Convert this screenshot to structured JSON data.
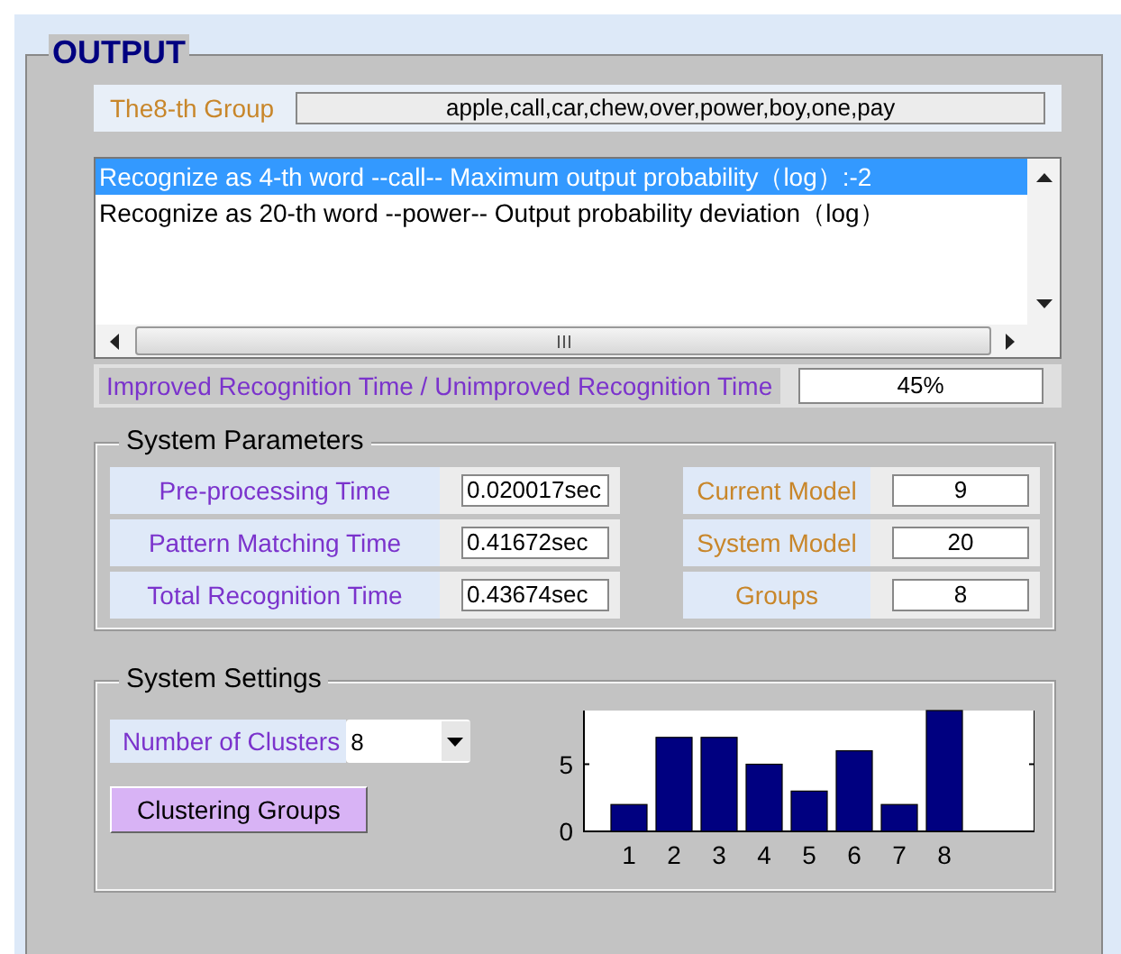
{
  "panel": {
    "title": "OUTPUT"
  },
  "group": {
    "label": "The8-th Group",
    "value": "apple,call,car,chew,over,power,boy,one,pay"
  },
  "results": [
    {
      "text": "Recognize as 4-th word --call-- Maximum output probability（log）:-2",
      "selected": true
    },
    {
      "text": "Recognize as 20-th word --power-- Output probability deviation（log）",
      "selected": false
    }
  ],
  "ratio": {
    "label": "Improved Recognition Time / Unimproved Recognition Time",
    "value": "45%"
  },
  "system_parameters": {
    "title": "System Parameters",
    "times": [
      {
        "label": "Pre-processing Time",
        "value": "0.020017sec"
      },
      {
        "label": "Pattern Matching Time",
        "value": "0.41672sec"
      },
      {
        "label": "Total Recognition Time",
        "value": "0.43674sec"
      }
    ],
    "models": [
      {
        "label": "Current Model",
        "value": "9"
      },
      {
        "label": "System Model",
        "value": "20"
      },
      {
        "label": "Groups",
        "value": "8"
      }
    ]
  },
  "system_settings": {
    "title": "System Settings",
    "clusters": {
      "label": "Number of Clusters",
      "value": "8"
    },
    "button": "Clustering Groups",
    "chart_data": {
      "type": "bar",
      "categories": [
        "1",
        "2",
        "3",
        "4",
        "5",
        "6",
        "7",
        "8"
      ],
      "series": [
        {
          "color": "#000080",
          "values": [
            2,
            7,
            7,
            5,
            3,
            6,
            2,
            9
          ]
        }
      ],
      "ylim": [
        0,
        9
      ],
      "yticks": [
        0,
        5
      ]
    }
  }
}
